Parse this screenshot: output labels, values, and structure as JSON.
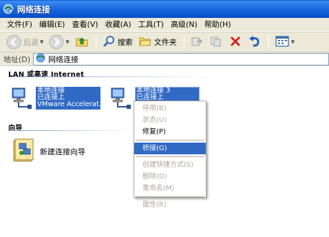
{
  "window": {
    "title": "网络连接"
  },
  "menu": [
    "文件(F)",
    "编辑(E)",
    "查看(V)",
    "收藏(A)",
    "工具(T)",
    "高级(N)",
    "帮助(H)"
  ],
  "toolbar": {
    "back_label": "后退",
    "search_label": "搜索",
    "folders_label": "文件夹"
  },
  "address": {
    "label": "地址(D)",
    "value": "网络连接"
  },
  "groups": {
    "lan": "LAN 或高速 Internet",
    "wizard": "向导"
  },
  "connections": [
    {
      "name": "本地连接",
      "status": "已连接上",
      "device": "VMware Accelerat..."
    },
    {
      "name": "本地连接 3",
      "status": "已连接上",
      "device": ""
    }
  ],
  "wizard": {
    "label": "新建连接向导"
  },
  "context_menu": {
    "disable": "停用(B)",
    "status": "状态(U)",
    "repair": "修复(P)",
    "bridge": "桥接(G)",
    "shortcut": "创建快捷方式(S)",
    "delete": "删除(D)",
    "rename": "重命名(M)",
    "properties": "属性(R)"
  }
}
